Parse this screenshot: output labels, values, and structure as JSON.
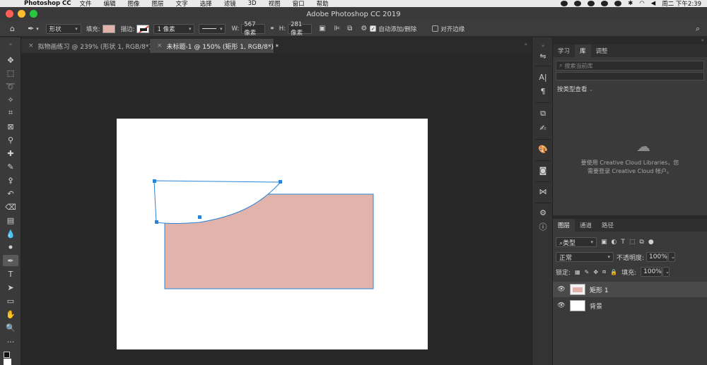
{
  "menubar": {
    "app_name": "Photoshop CC",
    "items": [
      "文件",
      "编辑",
      "图像",
      "图层",
      "文字",
      "选择",
      "滤镜",
      "3D",
      "视图",
      "窗口",
      "帮助"
    ],
    "clock": "周二 下午2:39"
  },
  "window": {
    "title": "Adobe Photoshop CC 2019"
  },
  "options": {
    "mode": "形状",
    "fill_label": "填充:",
    "fill_color": "#e2b3aa",
    "stroke_label": "描边:",
    "stroke_width": "1 像素",
    "w_label": "W:",
    "w_value": "567 像素",
    "h_label": "H:",
    "h_value": "281 像素",
    "auto_add": "自动添加/删除",
    "align_edges": "对齐边缘"
  },
  "tabs": [
    {
      "label": "拟物画练习 @ 239% (形状 1, RGB/8*) *"
    },
    {
      "label": "未标题-1 @ 150% (矩形 1, RGB/8*) *"
    }
  ],
  "canvas": {
    "shape_fill": "#e2b3aa",
    "path_color": "#2a84d8"
  },
  "libraries": {
    "tabs": [
      "学习",
      "库",
      "调整"
    ],
    "search_placeholder": "搜索当前库",
    "view_by": "按类型查看",
    "message_line1": "要使用 Creative Cloud Libraries，您",
    "message_line2": "需要登录 Creative Cloud 帐户。"
  },
  "layers": {
    "tabs": [
      "图层",
      "通道",
      "路径"
    ],
    "filter": "类型",
    "blend_mode": "正常",
    "opacity_label": "不透明度:",
    "opacity": "100%",
    "lock_label": "锁定:",
    "fill_label": "填充:",
    "fill": "100%",
    "rows": [
      {
        "name": "矩形 1"
      },
      {
        "name": "背景"
      }
    ]
  },
  "colors": {
    "accent": "#2a84d8",
    "panel_bg": "#3a3a3a"
  }
}
